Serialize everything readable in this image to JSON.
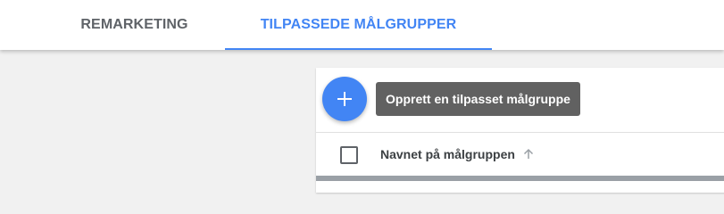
{
  "tabs": [
    {
      "label": "REMARKETING",
      "active": false
    },
    {
      "label": "TILPASSEDE MÅLGRUPPER",
      "active": true
    }
  ],
  "fab": {
    "icon": "plus-icon"
  },
  "tooltip": {
    "text": "Opprett en tilpasset målgruppe"
  },
  "table": {
    "columns": [
      {
        "label": "Navnet på målgruppen",
        "sort": "ascending",
        "sort_icon": "arrow-up-icon"
      }
    ]
  },
  "colors": {
    "accent": "#4285f4",
    "tooltip_bg": "#616161",
    "inactive_tab": "#5f6368",
    "background": "#f1f1f1"
  }
}
